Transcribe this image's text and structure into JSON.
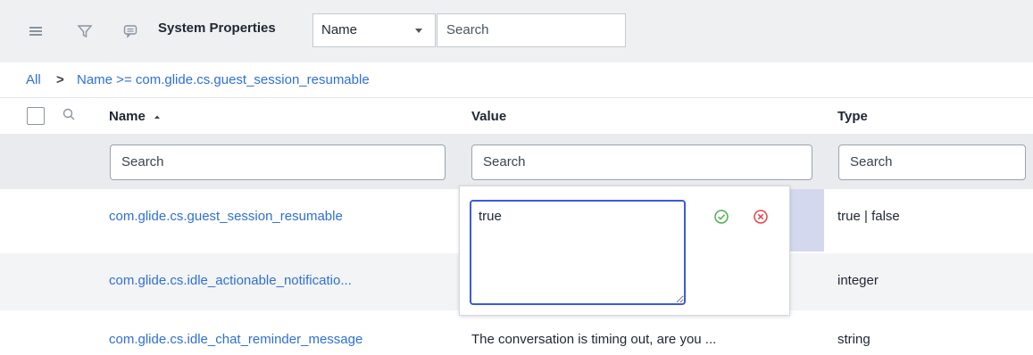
{
  "toolbar": {
    "title": "System Properties",
    "field_select": "Name",
    "search_placeholder": "Search"
  },
  "breadcrumb": {
    "all": "All",
    "separator": ">",
    "filter": "Name >= com.glide.cs.guest_session_resumable"
  },
  "columns": {
    "name": "Name",
    "value": "Value",
    "type": "Type"
  },
  "filters": {
    "name_placeholder": "Search",
    "value_placeholder": "Search",
    "type_placeholder": "Search"
  },
  "rows": [
    {
      "name": "com.glide.cs.guest_session_resumable",
      "value": "",
      "type": "true | false"
    },
    {
      "name": "com.glide.cs.idle_actionable_notificatio...",
      "value": "",
      "type": "integer"
    },
    {
      "name": "com.glide.cs.idle_chat_reminder_message",
      "value": "The conversation is timing out, are you ...",
      "type": "string"
    }
  ],
  "inline_editor": {
    "value": "true"
  },
  "colors": {
    "link": "#2f6fd6",
    "toolbar_bg": "#eef0f2",
    "accept": "#4caf50",
    "cancel": "#e0474c",
    "editor_border": "#3b5ad8"
  },
  "icons": [
    "hamburger-menu-icon",
    "filter-funnel-icon",
    "context-menu-icon",
    "search-icon",
    "sort-ascending-icon",
    "check-circle-icon",
    "cancel-circle-icon"
  ]
}
